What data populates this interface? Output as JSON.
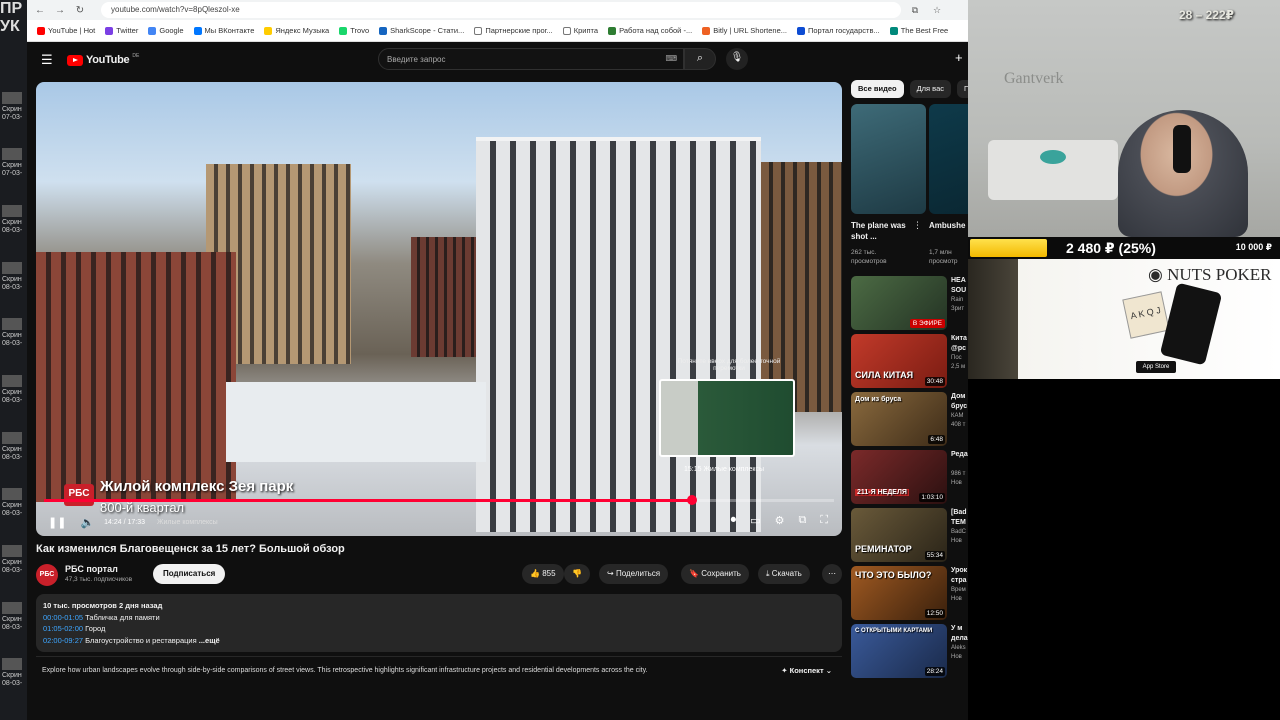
{
  "desktop": {
    "big_letters_1": "ПР",
    "big_letters_2": "УК",
    "icons": [
      {
        "label": "Скрин 07-03-"
      },
      {
        "label": "Скрин 07-03-"
      },
      {
        "label": "Скрин 08-03-"
      },
      {
        "label": "Скрин 08-03-"
      },
      {
        "label": "Скрин 08-03-"
      },
      {
        "label": "Скрин 08-03-"
      },
      {
        "label": "Скрин 08-03-"
      },
      {
        "label": "Скрин 08-03-"
      },
      {
        "label": "Скрин 08-03-"
      },
      {
        "label": "Скрин 08-03-"
      },
      {
        "label": "Скрин 08-03-"
      }
    ]
  },
  "browser": {
    "url": "youtube.com/watch?v=8pQleszol-xe",
    "bookmarks": [
      {
        "label": "YouTube | Hot",
        "color": "#ff0000"
      },
      {
        "label": "Twitter",
        "color": "#7b3fe4"
      },
      {
        "label": "Google",
        "color": "#4285f4"
      },
      {
        "label": "Мы ВКонтакте",
        "color": "#0077ff"
      },
      {
        "label": "Яндекс Музыка",
        "color": "#ffcc00"
      },
      {
        "label": "Trovo",
        "color": "#19d66b"
      },
      {
        "label": "SharkScope - Стати...",
        "color": "#1565c0"
      },
      {
        "label": "Партнерские прог...",
        "color": "#777777"
      },
      {
        "label": "Крипта",
        "color": "#777777"
      },
      {
        "label": "Работа над собой -...",
        "color": "#2e7d32"
      },
      {
        "label": "Bitly | URL Shortene...",
        "color": "#ee6123"
      },
      {
        "label": "Портал государств...",
        "color": "#0d4cd3"
      },
      {
        "label": "The Best Free",
        "color": "#00897b"
      }
    ]
  },
  "header": {
    "logo": "YouTube",
    "logo_country": "DE",
    "search_placeholder": "Введите запрос"
  },
  "video": {
    "overlay_badge": "РБС",
    "overlay_title": "Жилой комплекс Зея парк",
    "overlay_subtitle": "800-й квартал",
    "preview_hint": "Потяните вверх для более точной перемотки",
    "preview_time": "15:15  Жилые комплексы",
    "time": "14:24 / 17:33",
    "chapter": "Жилые комплексы",
    "progress": 0.82
  },
  "watch": {
    "title": "Как изменился Благовещенск за 15 лет? Большой обзор",
    "channel_avatar": "РБС",
    "channel_name": "РБС портал",
    "channel_subs": "47,3 тыс. подписчиков",
    "subscribe_label": "Подписаться",
    "like_count": "855",
    "share_label": "Поделиться",
    "save_label": "Сохранить",
    "download_label": "Скачать",
    "views_date": "10 тыс. просмотров  2 дня назад",
    "chapters": [
      {
        "time": "00:00-01:05",
        "label": "Табличка для памяти"
      },
      {
        "time": "01:05-02:00",
        "label": "Город"
      },
      {
        "time": "02:00-09:27",
        "label": "Благоустройство и реставрация"
      }
    ],
    "more_label": "...ещё",
    "summary": "Explore how urban landscapes evolve through side-by-side comparisons of street views. This retrospective highlights significant infrastructure projects and residential developments across the city.",
    "konspekt_label": "Конспект"
  },
  "sidebar": {
    "chips": [
      "Все видео",
      "Для вас",
      "П"
    ],
    "shorts": [
      {
        "title": "The plane was shot ...",
        "meta1": "262 тыс.",
        "meta2": "просмотров"
      },
      {
        "title": "Ambushe",
        "meta1": "1,7 млн",
        "meta2": "просмотр"
      }
    ],
    "recs": [
      {
        "thumb_text": "",
        "badge": "В ЭФИРЕ",
        "title": "HEA",
        "title2": "SOU",
        "meta1": "Rain",
        "meta2": "Зрит",
        "color": "#3d5a3a"
      },
      {
        "thumb_text": "СИЛА КИТАЯ",
        "badge": "30:48",
        "title": "Кита",
        "title2": "@pc",
        "meta1": "Пос",
        "meta2": "2,5 м",
        "color": "#b3261e"
      },
      {
        "thumb_text": "Дом из бруса",
        "badge": "6:48",
        "title": "Дом",
        "title2": "брус",
        "meta1": "КАМ",
        "meta2": "408 т",
        "color": "#6b4a2a"
      },
      {
        "thumb_text": "211-Я НЕДЕЛЯ",
        "badge": "1:03:10",
        "title": "Реда",
        "title2": "",
        "meta1": "986 т",
        "meta2": "Нов",
        "color": "#5a1f1f"
      },
      {
        "thumb_text": "РЕМИНАТОР",
        "badge": "55:34",
        "title": "[Bad",
        "title2": "ТЕМ",
        "meta1": "BadC",
        "meta2": "Нов",
        "color": "#4b3a2a"
      },
      {
        "thumb_text": "ЧТО ЭТО БЫЛО?",
        "badge": "12:50",
        "title": "Урок",
        "title2": "стра",
        "meta1": "Врем",
        "meta2": "Нов",
        "color": "#7a4a1a"
      },
      {
        "thumb_text": "С ОТКРЫТЫМИ КАРТАМИ",
        "badge": "28:24",
        "title": "У м",
        "title2": "дела",
        "meta1": "Aleks",
        "meta2": "Нов",
        "color": "#2a3f6a"
      }
    ]
  },
  "stream": {
    "counter": "28 – 222₽",
    "wall_text": "Gantverk",
    "donation_amount": "2 480 ₽ (25%)",
    "donation_goal": "10 000 ₽",
    "donation_progress": 0.25,
    "ad_brand": "NUTS POKER",
    "ad_cards_text": "A K Q J",
    "ad_store": "App Store"
  }
}
